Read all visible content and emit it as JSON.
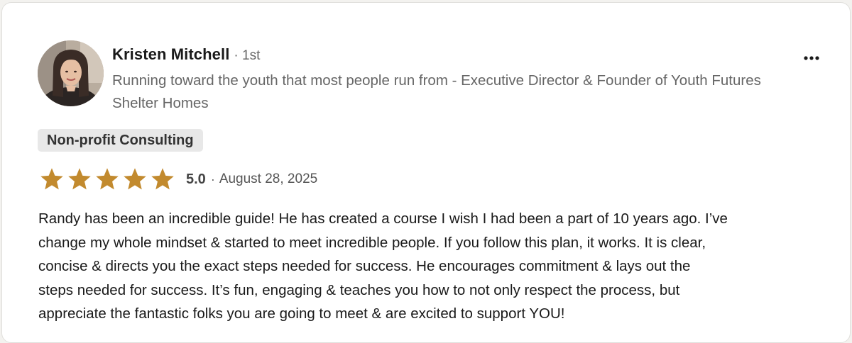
{
  "review": {
    "author": {
      "name": "Kristen Mitchell",
      "connection": "· 1st",
      "headline": "Running toward the youth that most people run from - Executive Director & Founder of Youth Futures Shelter Homes"
    },
    "more_icon": "ellipsis-horizontal-icon",
    "service_tag": "Non-profit Consulting",
    "rating": {
      "stars": 5,
      "max_stars": 5,
      "value": "5.0",
      "separator": "·",
      "star_color": "#c28a2e"
    },
    "date": "August 28, 2025",
    "text": "Randy has been an incredible guide! He has created a course I wish I had been a part of 10 years ago. I’ve\nchange my whole mindset & started to meet incredible people. If you follow this plan, it works. It is clear,\nconcise & directs you the exact steps needed for success. He encourages commitment & lays out the\nsteps needed for success. It’s fun, engaging & teaches you how to not only respect the process, but\nappreciate the fantastic folks you are going to meet & are excited to support YOU!"
  }
}
